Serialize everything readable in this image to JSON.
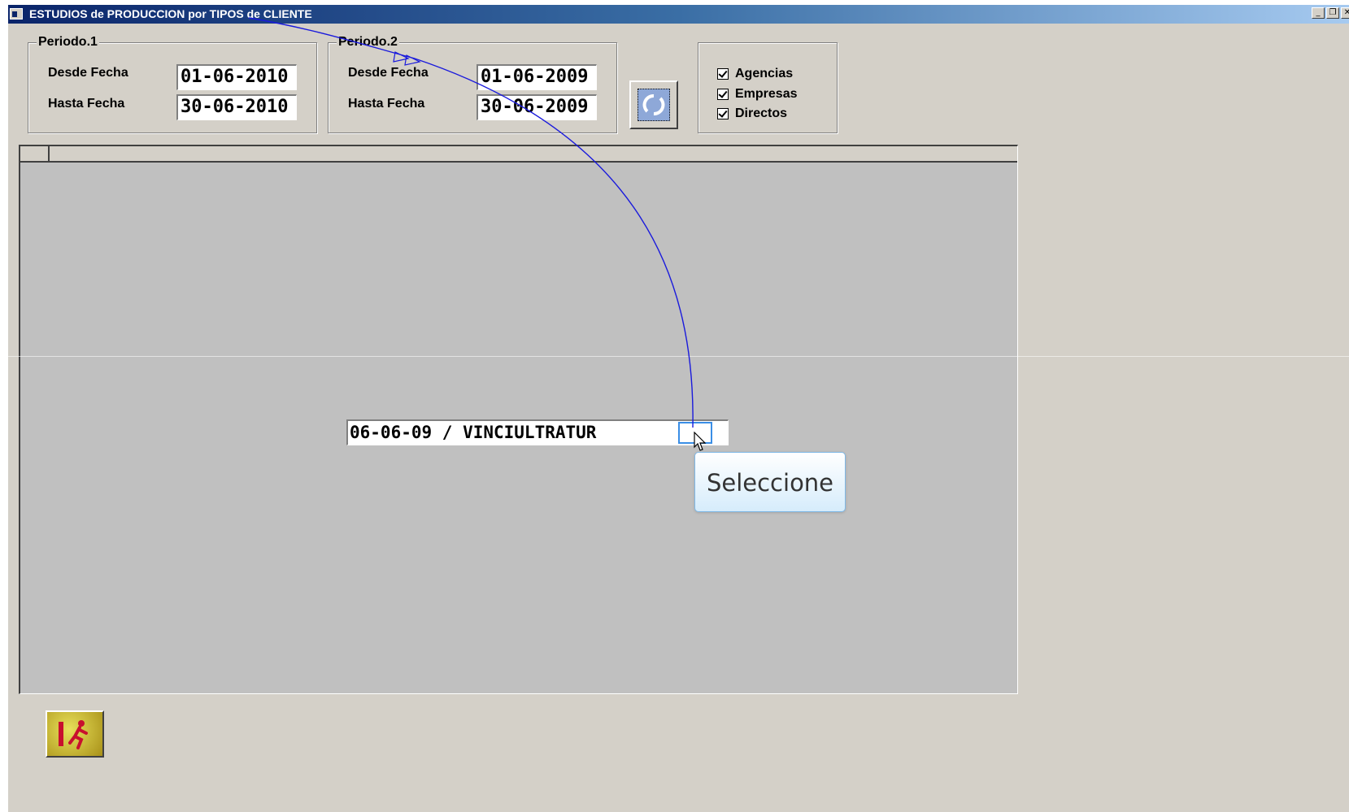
{
  "window": {
    "title": "ESTUDIOS de PRODUCCION por TIPOS de CLIENTE",
    "minimize_glyph": "_",
    "restore_glyph": "❐",
    "close_glyph": "✕"
  },
  "periodo1": {
    "legend": "Periodo.1",
    "desde_label": "Desde Fecha",
    "desde_value": "01-06-2010",
    "hasta_label": "Hasta Fecha",
    "hasta_value": "30-06-2010"
  },
  "periodo2": {
    "legend": "Periodo.2",
    "desde_label": "Desde Fecha",
    "desde_value": "01-06-2009",
    "hasta_label": "Hasta Fecha",
    "hasta_value": "30-06-2009"
  },
  "refresh_button": {
    "icon": "refresh-icon"
  },
  "tipos_cliente": [
    {
      "label": "Agencias",
      "checked": true
    },
    {
      "label": "Empresas",
      "checked": true
    },
    {
      "label": "Directos",
      "checked": true
    }
  ],
  "combo": {
    "value": "06-06-09 / VINCIULTRATUR"
  },
  "tooltip": {
    "text": "Seleccione"
  },
  "exit_button": {
    "icon": "exit-running-man-icon"
  },
  "colors": {
    "titlebar_start": "#0a246a",
    "titlebar_end": "#a6caf0",
    "window_bg": "#d4d0c8",
    "grid_bg": "#c0c0c0",
    "annotation_arrow": "#1a1adc"
  }
}
